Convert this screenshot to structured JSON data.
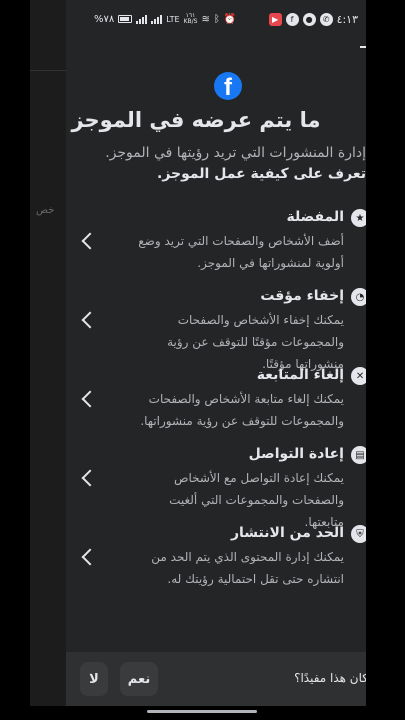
{
  "status_bar": {
    "time": "٤:١٣",
    "battery": "%٧٨",
    "network_speed": "١٦١\nKB/S",
    "network_type": "LTE"
  },
  "background": {
    "partial_text": "خص"
  },
  "sheet": {
    "title": "ما يتم عرضه في الموجز",
    "subtitle": "إدارة المنشورات التي تريد رؤيتها في الموجز.",
    "learn_more": "تعرف على كيفية عمل الموجز.",
    "items": [
      {
        "title": "المفضلة",
        "desc": "أضف الأشخاص والصفحات التي تريد وضع أولوية لمنشوراتها في الموجز.",
        "icon": "star-icon"
      },
      {
        "title": "إخفاء مؤقت",
        "desc": "يمكنك إخفاء الأشخاص والصفحات والمجموعات مؤقتًا للتوقف عن رؤية منشوراتها مؤقتًا.",
        "icon": "snooze-icon"
      },
      {
        "title": "إلغاء المتابعة",
        "desc": "يمكنك إلغاء متابعة الأشخاص والصفحات والمجموعات للتوقف عن رؤية منشوراتها.",
        "icon": "unfollow-icon"
      },
      {
        "title": "إعادة التواصل",
        "desc": "يمكنك إعادة التواصل مع الأشخاص والصفحات والمجموعات التي ألغيت متابعتها.",
        "icon": "reconnect-icon"
      },
      {
        "title": "الحد من الانتشار",
        "desc": "يمكنك إدارة المحتوى الذي يتم الحد من انتشاره حتى تقل احتمالية رؤيتك له.",
        "icon": "shield-icon"
      }
    ]
  },
  "footer": {
    "question": "كان هذا مفيدًا؟",
    "yes_label": "نعم",
    "no_label": "لا"
  },
  "colors": {
    "sheet_bg": "#242526",
    "brand": "#1877f2",
    "text_primary": "#e4e6eb",
    "text_secondary": "#b0b3b8"
  }
}
